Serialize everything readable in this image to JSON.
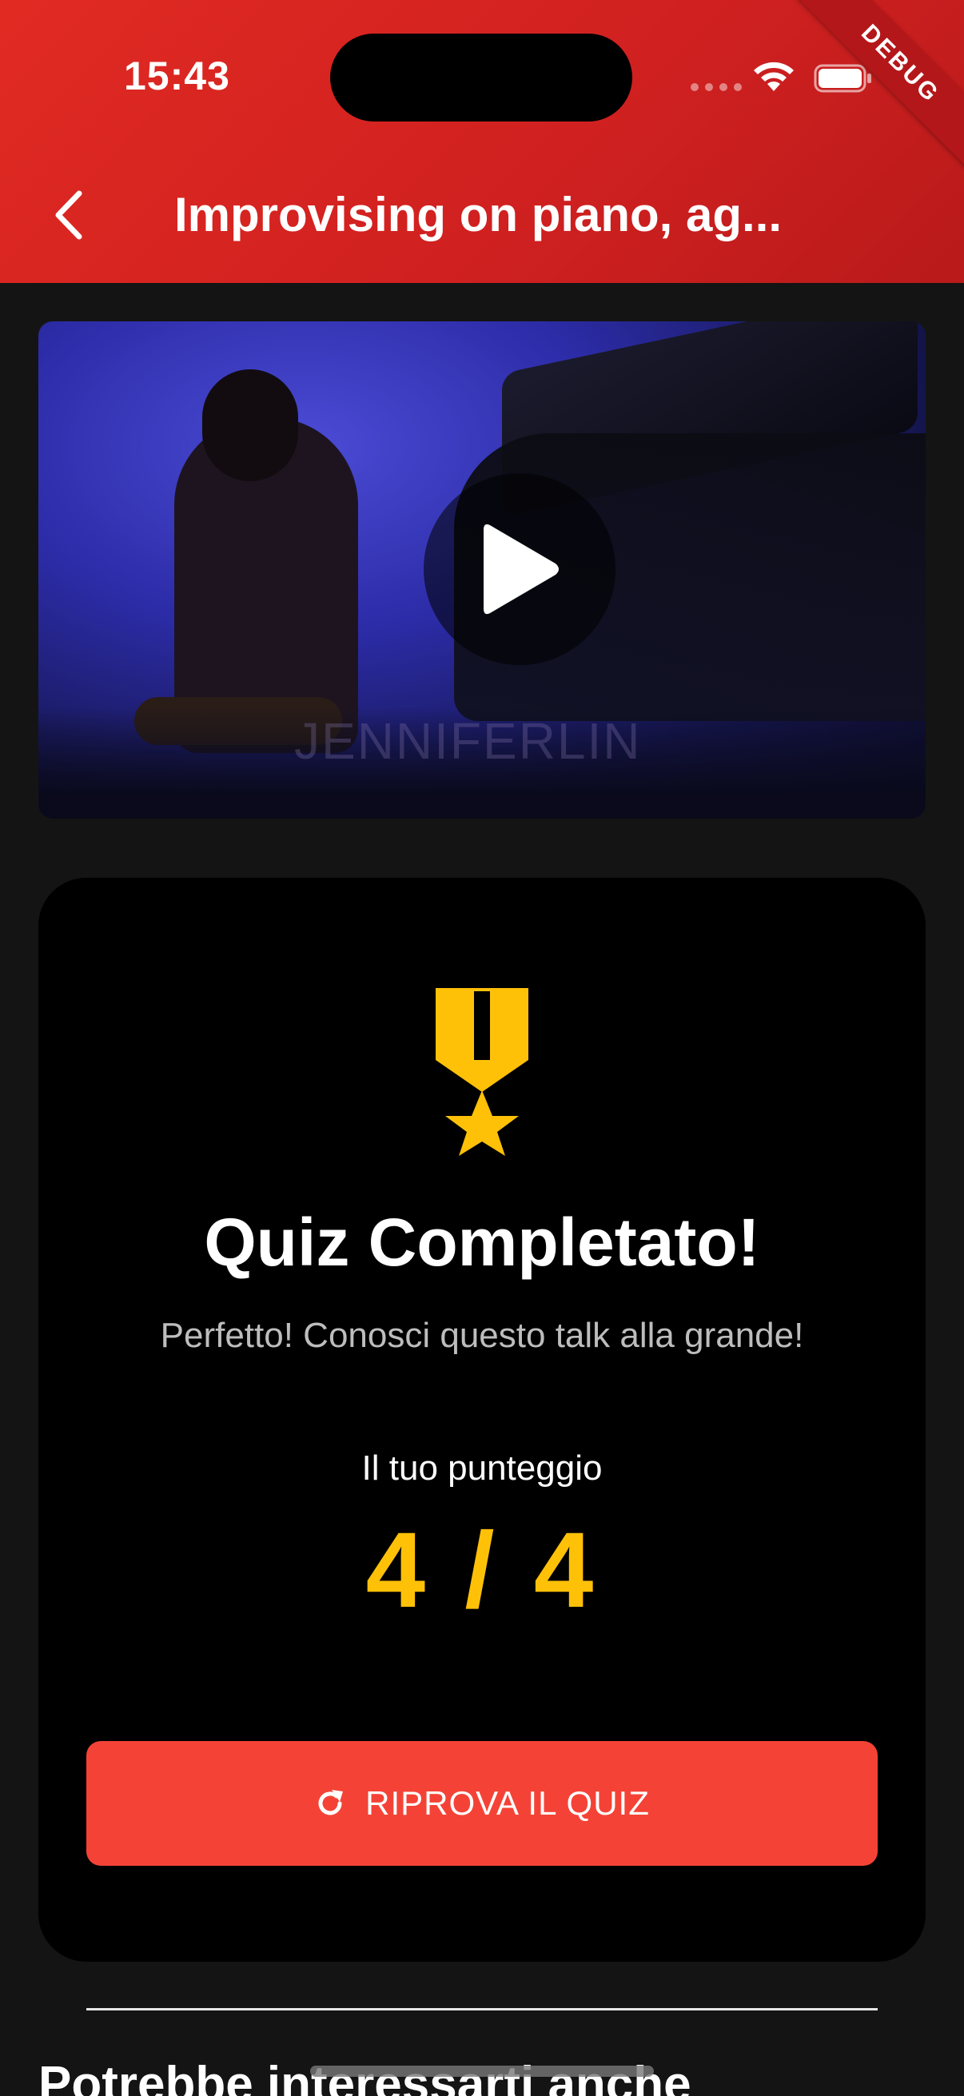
{
  "status_bar": {
    "time": "15:43",
    "debug_label": "DEBUG"
  },
  "header": {
    "title": "Improvising on piano, ag...",
    "back_icon": "chevron-left-icon"
  },
  "video": {
    "watermark": "JENNIFERLIN",
    "play_icon": "play-icon"
  },
  "quiz": {
    "icon": "military-medal-icon",
    "title": "Quiz Completato!",
    "subtitle": "Perfetto! Conosci questo talk alla grande!",
    "score_label": "Il tuo punteggio",
    "score": "4 / 4",
    "retry_button": "RIPROVA IL QUIZ",
    "retry_icon": "refresh-icon"
  },
  "related": {
    "title": "Potrebbe interessarti anche"
  },
  "colors": {
    "header_red": "#d62422",
    "accent_gold": "#ffc107",
    "button_red": "#f44336",
    "card_bg": "#000000",
    "page_bg": "#141414"
  }
}
